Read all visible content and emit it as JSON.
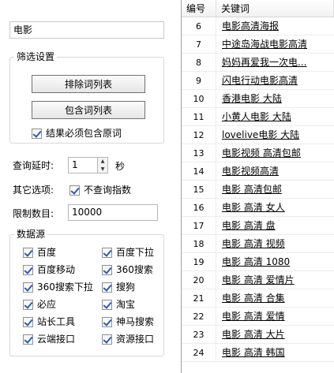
{
  "keyword_input": {
    "value": "电影"
  },
  "filter_settings": {
    "title": "筛选设置",
    "exclude_button": "排除词列表",
    "include_button": "包含词列表",
    "must_contain_label": "结果必须包含原词"
  },
  "query_delay": {
    "label": "查询延时:",
    "value": "1",
    "unit": "秒"
  },
  "other_options": {
    "label": "其它选项:",
    "no_index_label": "不查询指数"
  },
  "limit": {
    "label": "限制数目:",
    "value": "10000"
  },
  "data_sources": {
    "title": "数据源",
    "items": [
      "百度",
      "百度下拉",
      "百度移动",
      "360搜索",
      "360搜索下拉",
      "搜狗",
      "必应",
      "淘宝",
      "站长工具",
      "神马搜索",
      "云端接口",
      "资源接口"
    ]
  },
  "table": {
    "headers": {
      "num": "编号",
      "keyword": "关键词"
    },
    "rows": [
      {
        "num": "6",
        "keyword": "电影高清海报"
      },
      {
        "num": "7",
        "keyword": "中途岛海战电影高清"
      },
      {
        "num": "8",
        "keyword": "妈妈再爱我一次电..."
      },
      {
        "num": "9",
        "keyword": "闪电行动电影高清"
      },
      {
        "num": "10",
        "keyword": "香港电影 大陆"
      },
      {
        "num": "11",
        "keyword": "小黄人电影 大陆"
      },
      {
        "num": "12",
        "keyword": "lovelive电影 大陆"
      },
      {
        "num": "13",
        "keyword": "电影视频 高清包邮"
      },
      {
        "num": "14",
        "keyword": "电影视频高清"
      },
      {
        "num": "15",
        "keyword": "电影 高清包邮"
      },
      {
        "num": "16",
        "keyword": "电影 高清 女人"
      },
      {
        "num": "17",
        "keyword": "电影 高清 盘"
      },
      {
        "num": "18",
        "keyword": "电影 高清 视频"
      },
      {
        "num": "19",
        "keyword": "电影 高清 1080"
      },
      {
        "num": "20",
        "keyword": "电影 高清 爱情片"
      },
      {
        "num": "21",
        "keyword": "电影 高清 合集"
      },
      {
        "num": "22",
        "keyword": "电影 高清 爱情"
      },
      {
        "num": "23",
        "keyword": "电影 高清 大片"
      },
      {
        "num": "24",
        "keyword": "电影 高清 韩国"
      }
    ]
  }
}
